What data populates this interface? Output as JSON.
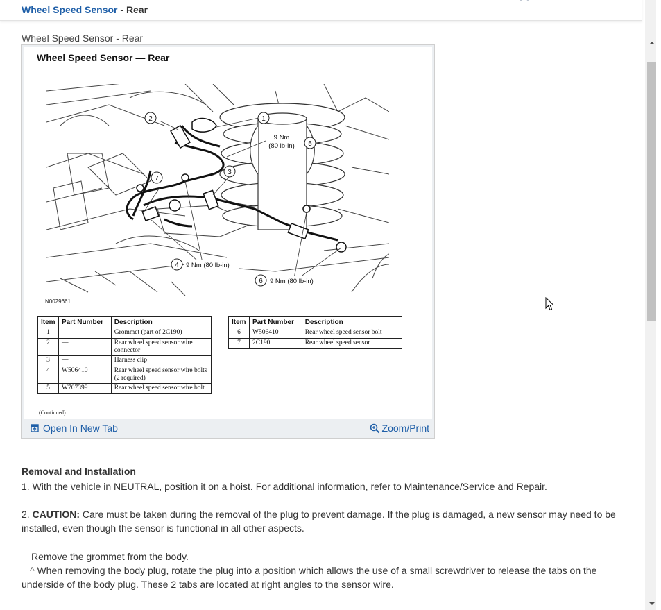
{
  "header": {
    "link_text": "Wheel Speed Sensor",
    "separator": " - ",
    "current": "Rear"
  },
  "figure": {
    "caption": "Wheel Speed Sensor - Rear",
    "title": "Wheel Speed Sensor — Rear",
    "callouts": {
      "c1": "1",
      "c2": "2",
      "c3": "3",
      "c4": "4",
      "c5": "5",
      "c6": "6",
      "c7": "7",
      "torque_5_line1": "9 Nm",
      "torque_5_line2": "(80 lb-in)",
      "torque_4": "9 Nm (80 lb-in)",
      "torque_6": "9 Nm (80 lb-in)"
    },
    "code": "N0029661",
    "continued": "(Continued)",
    "table_headers": [
      "Item",
      "Part Number",
      "Description"
    ],
    "table_left": [
      {
        "item": "1",
        "part": "—",
        "desc": "Grommet (part of 2C190)"
      },
      {
        "item": "2",
        "part": "—",
        "desc": "Rear wheel speed sensor wire connector"
      },
      {
        "item": "3",
        "part": "—",
        "desc": "Harness clip"
      },
      {
        "item": "4",
        "part": "W506410",
        "desc": "Rear wheel speed sensor wire bolts (2 required)"
      },
      {
        "item": "5",
        "part": "W707399",
        "desc": "Rear wheel speed sensor wire bolt"
      }
    ],
    "table_right": [
      {
        "item": "6",
        "part": "W506410",
        "desc": "Rear wheel speed sensor bolt"
      },
      {
        "item": "7",
        "part": "2C190",
        "desc": "Rear wheel speed sensor"
      }
    ],
    "open_tab_label": "Open In New Tab",
    "zoom_label": "Zoom/Print"
  },
  "content": {
    "heading": "Removal and Installation",
    "step1": " 1. With the vehicle in NEUTRAL, position it on a hoist. For additional information, refer to Maintenance/Service and Repair.",
    "step2_prefix": " 2. ",
    "step2_caution": "CAUTION:",
    "step2_text": " Care must be taken during the removal of the plug to prevent damage. If the plug is damaged, a new sensor may need to be installed, even though the sensor is functional in all other aspects.",
    "sub1": "Remove the grommet from the body.",
    "sub2": "^  When removing the body plug, rotate the plug into a position which allows the use of a small screwdriver to release the tabs on the underside of the body plug. These 2 tabs are located at right angles to the sensor wire."
  },
  "icons": {
    "open_tab": "open-in-new-tab-icon",
    "zoom": "magnifier-zoom-icon",
    "cursor": "mouse-pointer-icon"
  },
  "colors": {
    "link": "#1f5fa8",
    "text": "#333333",
    "scroll_thumb": "#c1c1c1"
  }
}
